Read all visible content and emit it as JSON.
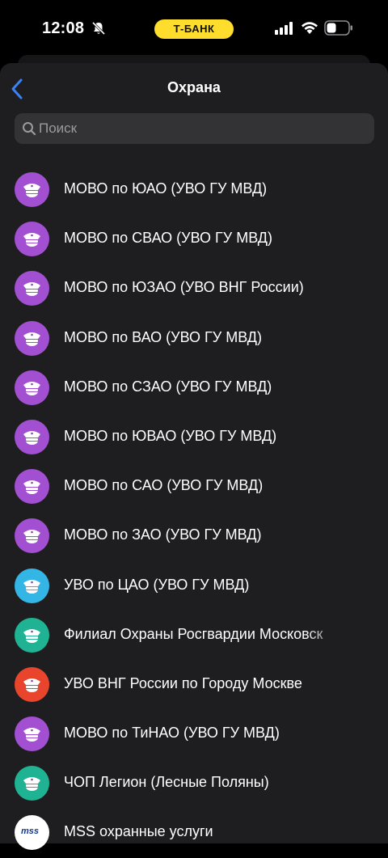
{
  "status_bar": {
    "time": "12:08",
    "bank_label": "Т-БАНК",
    "accent": "#ffdd2d"
  },
  "header": {
    "title": "Охрана",
    "back_icon": "chevron-left-icon",
    "back_color": "#3b82f6"
  },
  "search": {
    "placeholder": "Поиск",
    "value": ""
  },
  "items": [
    {
      "label": "МОВО по ЮАО (УВО ГУ МВД)",
      "color": "#a24fd1",
      "icon": "police-cap-icon"
    },
    {
      "label": "МОВО по СВАО (УВО ГУ МВД)",
      "color": "#a24fd1",
      "icon": "police-cap-icon"
    },
    {
      "label": "МОВО по ЮЗАО (УВО ВНГ России)",
      "color": "#a24fd1",
      "icon": "police-cap-icon"
    },
    {
      "label": "МОВО по ВАО (УВО ГУ МВД)",
      "color": "#a24fd1",
      "icon": "police-cap-icon"
    },
    {
      "label": "МОВО по СЗАО (УВО ГУ МВД)",
      "color": "#a24fd1",
      "icon": "police-cap-icon"
    },
    {
      "label": "МОВО по ЮВАО (УВО ГУ МВД)",
      "color": "#a24fd1",
      "icon": "police-cap-icon"
    },
    {
      "label": "МОВО по САО (УВО ГУ МВД)",
      "color": "#a24fd1",
      "icon": "police-cap-icon"
    },
    {
      "label": "МОВО по ЗАО (УВО ГУ МВД)",
      "color": "#a24fd1",
      "icon": "police-cap-icon"
    },
    {
      "label": "УВО по ЦАО (УВО ГУ МВД)",
      "color": "#33b5e5",
      "icon": "police-cap-icon"
    },
    {
      "label": "Филиал Охраны Росгвардии Московск",
      "color": "#1fb394",
      "icon": "police-cap-icon"
    },
    {
      "label": "УВО ВНГ России по Городу Москве",
      "color": "#e8452c",
      "icon": "police-cap-icon"
    },
    {
      "label": "МОВО по ТиНАО (УВО ГУ МВД)",
      "color": "#a24fd1",
      "icon": "police-cap-icon"
    },
    {
      "label": "ЧОП Легион (Лесные Поляны)",
      "color": "#1fb394",
      "icon": "police-cap-icon"
    },
    {
      "label": "MSS охранные услуги",
      "color": "#ffffff",
      "icon": "mss-logo-icon",
      "logo_text": "mss"
    }
  ]
}
